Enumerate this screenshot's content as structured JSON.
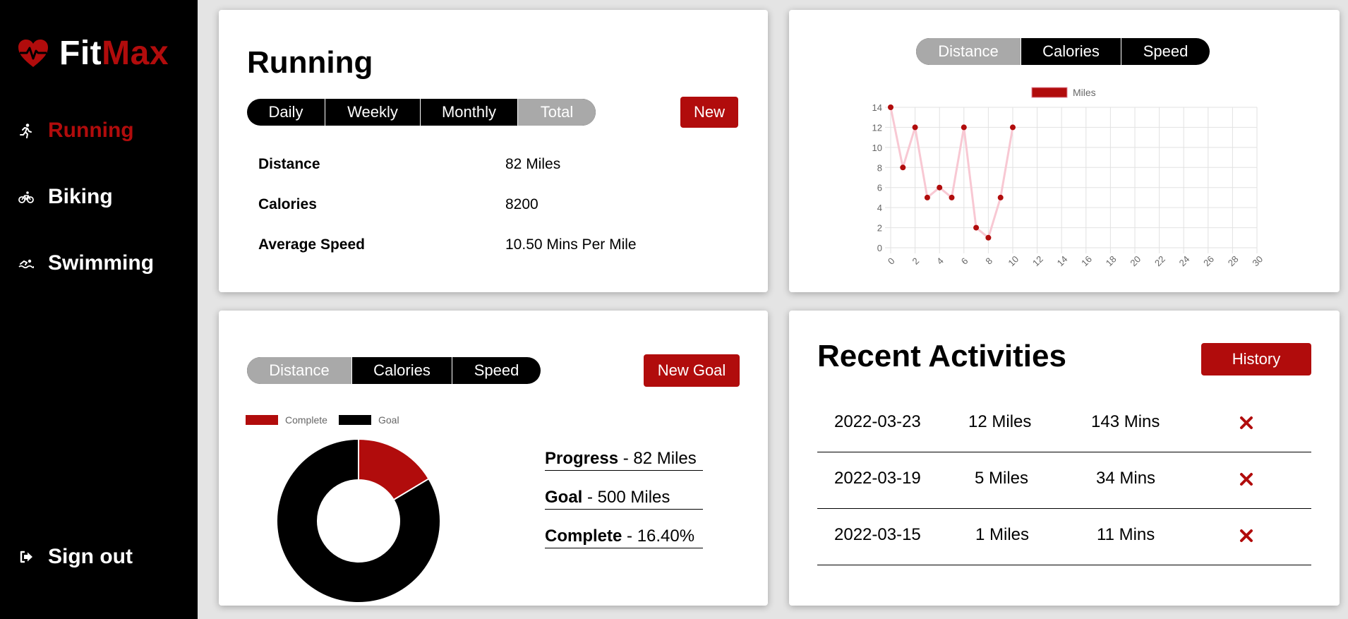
{
  "app": {
    "brand_fit": "Fit",
    "brand_max": "Max",
    "colors": {
      "accent": "#b10c0c",
      "sidebar_bg": "#000000",
      "segment_active": "#a9a9a9",
      "page_bg": "#e4e4e4"
    }
  },
  "sidebar": {
    "items": [
      {
        "label": "Running",
        "icon": "running-icon",
        "active": true
      },
      {
        "label": "Biking",
        "icon": "bike-icon",
        "active": false
      },
      {
        "label": "Swimming",
        "icon": "swimmer-icon",
        "active": false
      }
    ],
    "signout": {
      "label": "Sign out",
      "icon": "signout-icon"
    }
  },
  "summary": {
    "title": "Running",
    "tabs": [
      "Daily",
      "Weekly",
      "Monthly",
      "Total"
    ],
    "active_tab": "Total",
    "new_label": "New",
    "stats": [
      {
        "label": "Distance",
        "value": "82 Miles"
      },
      {
        "label": "Calories",
        "value": "8200"
      },
      {
        "label": "Average Speed",
        "value": "10.50 Mins Per Mile"
      }
    ]
  },
  "chart_panel": {
    "tabs": [
      "Distance",
      "Calories",
      "Speed"
    ],
    "active_tab": "Distance"
  },
  "chart_data": [
    {
      "type": "line",
      "legend": [
        "Miles"
      ],
      "series": [
        {
          "name": "Miles",
          "x": [
            0,
            1,
            2,
            3,
            4,
            5,
            6,
            7,
            8,
            9,
            10
          ],
          "values": [
            14,
            8,
            12,
            5,
            6,
            5,
            12,
            2,
            1,
            5,
            12
          ],
          "color": "#b10c0c"
        }
      ],
      "xlim": [
        0,
        30
      ],
      "ylim": [
        0,
        14
      ],
      "x_ticks": [
        0,
        2,
        4,
        6,
        8,
        10,
        12,
        14,
        16,
        18,
        20,
        22,
        24,
        26,
        28,
        30
      ],
      "y_ticks": [
        0,
        2,
        4,
        6,
        8,
        10,
        12,
        14
      ],
      "grid": true,
      "legend_position": "top"
    },
    {
      "type": "pie",
      "donut": true,
      "labels": [
        "Complete",
        "Goal"
      ],
      "values": [
        16.4,
        83.6
      ],
      "colors": [
        "#b10c0c",
        "#000000"
      ],
      "legend_position": "top"
    }
  ],
  "goal": {
    "tabs": [
      "Distance",
      "Calories",
      "Speed"
    ],
    "active_tab": "Distance",
    "new_goal_label": "New Goal",
    "lines": [
      {
        "label": "Progress",
        "value": " - 82 Miles"
      },
      {
        "label": "Goal",
        "value": " - 500 Miles"
      },
      {
        "label": "Complete",
        "value": " - 16.40%"
      }
    ]
  },
  "recent": {
    "title": "Recent Activities",
    "history_label": "History",
    "rows": [
      {
        "date": "2022-03-23",
        "distance": "12 Miles",
        "duration": "143 Mins"
      },
      {
        "date": "2022-03-19",
        "distance": "5 Miles",
        "duration": "34 Mins"
      },
      {
        "date": "2022-03-15",
        "distance": "1 Miles",
        "duration": "11 Mins"
      }
    ]
  }
}
